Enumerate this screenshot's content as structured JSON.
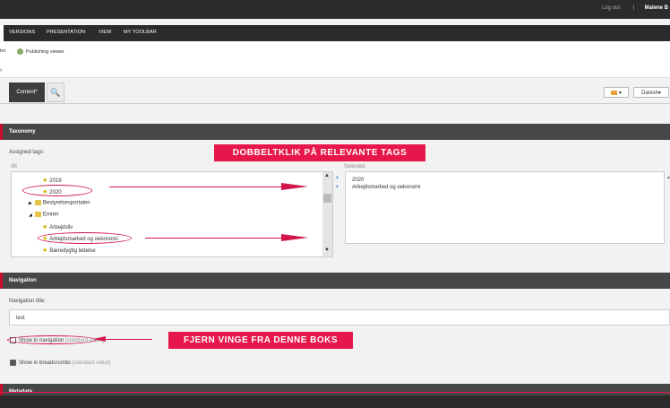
{
  "topbar": {
    "logout": "Log out",
    "separator": "|",
    "user": "Malene B"
  },
  "ribbon": {
    "tabs": [
      "VERSIONS",
      "PRESENTATION",
      "VIEW",
      "MY TOOLBAR"
    ],
    "items": {
      "partial": "tor",
      "publishing_viewer": "Publishing viewer"
    },
    "group_label": "h"
  },
  "editor": {
    "content_tab": "Content*",
    "language": "Danish"
  },
  "taxonomy": {
    "title": "Taxonomy",
    "assigned_label": "Assigned tags:",
    "all_label": "All",
    "selected_label": "Selected",
    "tree": [
      {
        "label": "2019",
        "type": "tag"
      },
      {
        "label": "2020",
        "type": "tag"
      },
      {
        "label": "Bestyrelsesportalen",
        "type": "folder"
      },
      {
        "label": "Emner",
        "type": "folder"
      },
      {
        "label": "Arbejdsliv",
        "type": "tag"
      },
      {
        "label": "Arbejdsmarked og oekonomi",
        "type": "tag"
      },
      {
        "label": "Bæredygtig ledelse",
        "type": "tag"
      }
    ],
    "selected": [
      "2020",
      "Arbejdsmarked og oekonomi"
    ]
  },
  "navigation": {
    "title": "Navigation",
    "nav_title_label": "Navigation title:",
    "nav_title_value": "test",
    "show_in_navigation": "Show in navigation",
    "show_in_navigation_std": "[standard value]",
    "show_in_breadcrumbs": "Show in breadcrumbs",
    "show_in_breadcrumbs_std": "[standard value]"
  },
  "metadata": {
    "title": "Metadata"
  },
  "annotations": {
    "tags_banner": "DOBBELTKLIK PÅ RELEVANTE TAGS",
    "checkbox_banner": "FJERN VINGE FRA DENNE BOKS"
  },
  "colors": {
    "accent": "#e8174b",
    "dark": "#2b2b2b",
    "link": "#2b6fb6"
  }
}
